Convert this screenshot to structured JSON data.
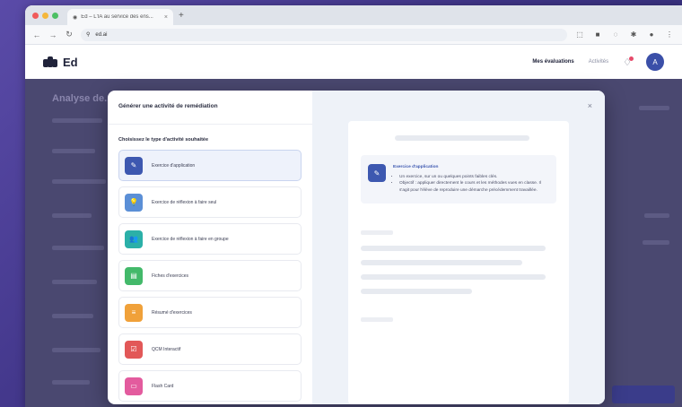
{
  "browser": {
    "tab_title": "Ed – L'IA au service des ens...",
    "url": "ed.ai",
    "window_dot_colors": [
      "#f05a5a",
      "#f5b73b",
      "#4cc064"
    ]
  },
  "header": {
    "logo_text": "Ed",
    "nav_primary": "Mes évaluations",
    "nav_secondary": "Activités",
    "avatar_initial": "A"
  },
  "background": {
    "page_title": "Analyse de..."
  },
  "modal": {
    "title": "Générer une activité de remédiation",
    "section_label": "Choisissez le type d'activité souhaitée",
    "close_label": "×",
    "types": [
      {
        "label": "Exercice d'application",
        "color": "#3d58b0",
        "icon": "pencil-icon",
        "glyph": "✎",
        "selected": true
      },
      {
        "label": "Exercice de réflexion à faire seul",
        "color": "#5b8fd6",
        "icon": "lightbulb-icon",
        "glyph": "💡",
        "selected": false
      },
      {
        "label": "Exercice de réflexion à faire en groupe",
        "color": "#2bb0a8",
        "icon": "group-icon",
        "glyph": "👥",
        "selected": false
      },
      {
        "label": "Fiches d'exercices",
        "color": "#43b96a",
        "icon": "document-icon",
        "glyph": "▤",
        "selected": false
      },
      {
        "label": "Résumé d'exercices",
        "color": "#f0a13a",
        "icon": "summary-icon",
        "glyph": "≡",
        "selected": false
      },
      {
        "label": "QCM Interactif",
        "color": "#e25858",
        "icon": "quiz-icon",
        "glyph": "☑",
        "selected": false
      },
      {
        "label": "Flash Card",
        "color": "#e35b9e",
        "icon": "card-icon",
        "glyph": "▭",
        "selected": false
      }
    ],
    "preview": {
      "title": "Exercice d'application",
      "bullets": [
        "Un exercice, sur un ou quelques points faibles clés.",
        "Objectif : appliquer directement le cours et les méthodes vues en classe. Il s'agit pour l'élève de reproduire une démarche précédemment travaillée."
      ]
    }
  }
}
